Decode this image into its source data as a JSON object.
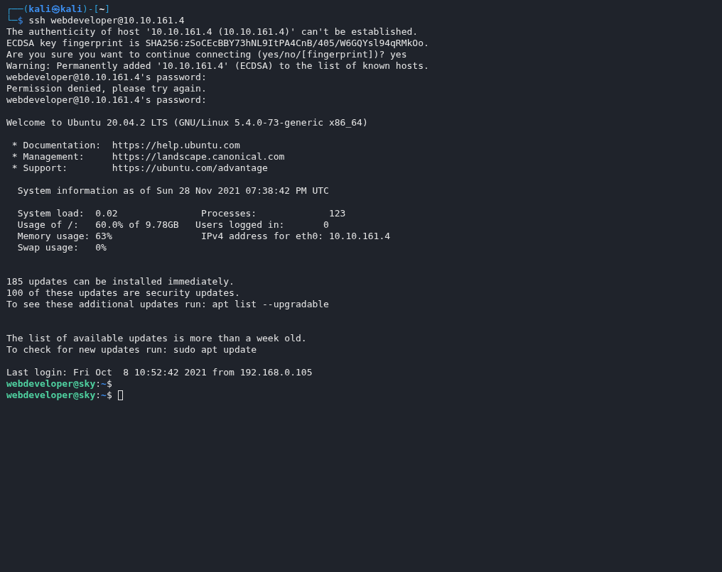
{
  "prompt": {
    "frame_top": "┌──(",
    "user": "kali",
    "at": "㉿",
    "host": "kali",
    "frame_mid": ")-[",
    "cwd": "~",
    "frame_close": "]",
    "frame_bottom": "└─",
    "symbol": "$",
    "command": "ssh webdeveloper@10.10.161.4"
  },
  "lines": [
    {
      "kind": "output",
      "text": "The authenticity of host '10.10.161.4 (10.10.161.4)' can't be established."
    },
    {
      "kind": "output",
      "text": "ECDSA key fingerprint is SHA256:zSoCEcBBY73hNL9ItPA4CnB/405/W6GQYsl94qRMkOo."
    },
    {
      "kind": "output",
      "text": "Are you sure you want to continue connecting (yes/no/[fingerprint])? yes"
    },
    {
      "kind": "output",
      "text": "Warning: Permanently added '10.10.161.4' (ECDSA) to the list of known hosts."
    },
    {
      "kind": "output",
      "text": "webdeveloper@10.10.161.4's password:"
    },
    {
      "kind": "output",
      "text": "Permission denied, please try again."
    },
    {
      "kind": "output",
      "text": "webdeveloper@10.10.161.4's password:"
    },
    {
      "kind": "blank"
    },
    {
      "kind": "output",
      "text": "Welcome to Ubuntu 20.04.2 LTS (GNU/Linux 5.4.0-73-generic x86_64)"
    },
    {
      "kind": "blank"
    },
    {
      "kind": "output",
      "text": " * Documentation:  https://help.ubuntu.com"
    },
    {
      "kind": "output",
      "text": " * Management:     https://landscape.canonical.com"
    },
    {
      "kind": "output",
      "text": " * Support:        https://ubuntu.com/advantage"
    },
    {
      "kind": "blank"
    },
    {
      "kind": "output",
      "text": "  System information as of Sun 28 Nov 2021 07:38:42 PM UTC"
    },
    {
      "kind": "blank"
    },
    {
      "kind": "output",
      "text": "  System load:  0.02               Processes:             123"
    },
    {
      "kind": "output",
      "text": "  Usage of /:   60.0% of 9.78GB   Users logged in:       0"
    },
    {
      "kind": "output",
      "text": "  Memory usage: 63%                IPv4 address for eth0: 10.10.161.4"
    },
    {
      "kind": "output",
      "text": "  Swap usage:   0%"
    },
    {
      "kind": "blank"
    },
    {
      "kind": "blank"
    },
    {
      "kind": "output",
      "text": "185 updates can be installed immediately."
    },
    {
      "kind": "output",
      "text": "100 of these updates are security updates."
    },
    {
      "kind": "output",
      "text": "To see these additional updates run: apt list --upgradable"
    },
    {
      "kind": "blank"
    },
    {
      "kind": "blank"
    },
    {
      "kind": "output",
      "text": "The list of available updates is more than a week old."
    },
    {
      "kind": "output",
      "text": "To check for new updates run: sudo apt update"
    },
    {
      "kind": "blank"
    },
    {
      "kind": "output",
      "text": "Last login: Fri Oct  8 10:52:42 2021 from 192.168.0.105"
    },
    {
      "kind": "remote_prompt",
      "user_host": "webdeveloper@sky",
      "sep": ":",
      "cwd": "~",
      "symbol": "$",
      "cursor": false
    },
    {
      "kind": "remote_prompt",
      "user_host": "webdeveloper@sky",
      "sep": ":",
      "cwd": "~",
      "symbol": "$",
      "cursor": true
    }
  ]
}
